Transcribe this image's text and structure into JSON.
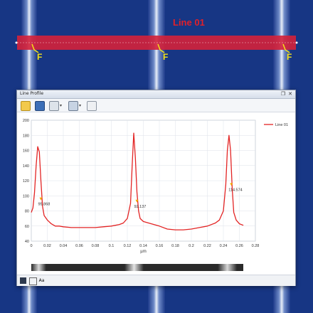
{
  "overlay": {
    "line_label": "Line 01",
    "focus_marker": "F"
  },
  "window": {
    "title": "Line Profile",
    "toolbar_icons": [
      "folder-icon",
      "save-icon",
      "image-icon",
      "export-icon",
      "edit-icon"
    ],
    "status_icons": [
      "view-icon",
      "table-icon",
      "aa-icon"
    ],
    "status_icon_text": "Aa"
  },
  "colors": {
    "series": "#e32424",
    "marker": "#f2a900",
    "background_blue": "#1b3a8c",
    "title_red": "#e0202a",
    "marker_yellow": "#f3e21a"
  },
  "chart_data": {
    "type": "line",
    "xlabel": "µm",
    "ylabel": "",
    "xlim": [
      0,
      0.28
    ],
    "ylim": [
      40,
      200
    ],
    "xticks": [
      "0",
      "0.02",
      "0.04",
      "0.06",
      "0.08",
      "0.1",
      "0.12",
      "0.14",
      "0.16",
      "0.18",
      "0.2",
      "0.22",
      "0.24",
      "0.26",
      "0.28"
    ],
    "yticks": [
      "40",
      "60",
      "80",
      "100",
      "120",
      "140",
      "160",
      "180",
      "200"
    ],
    "grid": true,
    "legend_position": "right",
    "series": [
      {
        "name": "Line 01",
        "x": [
          0,
          0.002,
          0.004,
          0.006,
          0.008,
          0.01,
          0.012,
          0.014,
          0.016,
          0.02,
          0.025,
          0.03,
          0.035,
          0.04,
          0.05,
          0.06,
          0.07,
          0.08,
          0.09,
          0.1,
          0.11,
          0.115,
          0.12,
          0.124,
          0.126,
          0.128,
          0.13,
          0.132,
          0.134,
          0.136,
          0.14,
          0.15,
          0.16,
          0.17,
          0.18,
          0.19,
          0.2,
          0.21,
          0.22,
          0.23,
          0.235,
          0.24,
          0.243,
          0.245,
          0.247,
          0.249,
          0.251,
          0.253,
          0.256,
          0.26,
          0.265
        ],
        "y": [
          78,
          84,
          104,
          140,
          165,
          158,
          120,
          86,
          74,
          68,
          63,
          60,
          60,
          59,
          58,
          58,
          58,
          58,
          59,
          60,
          62,
          64,
          70,
          90,
          140,
          183,
          150,
          105,
          80,
          70,
          66,
          63,
          60,
          56,
          55,
          55,
          56,
          58,
          60,
          64,
          68,
          80,
          115,
          160,
          180,
          160,
          110,
          78,
          68,
          63,
          61
        ]
      }
    ],
    "annotations": [
      {
        "x": 0.012,
        "y": 95,
        "label": "95.868"
      },
      {
        "x": 0.132,
        "y": 92,
        "label": "92.137"
      },
      {
        "x": 0.25,
        "y": 114,
        "label": "114.574"
      }
    ]
  }
}
